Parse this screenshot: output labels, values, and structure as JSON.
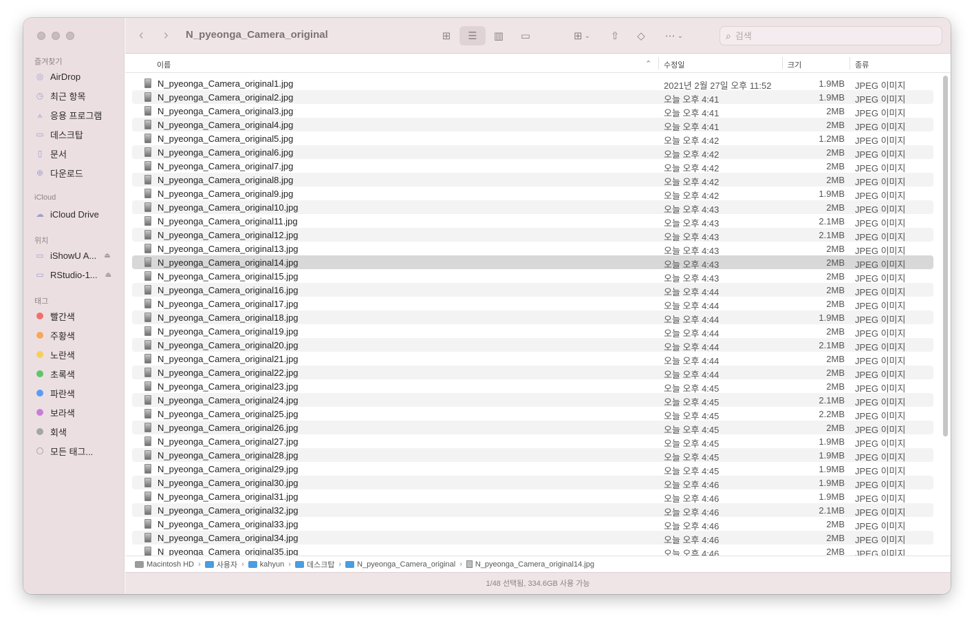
{
  "window": {
    "title": "N_pyeonga_Camera_original"
  },
  "search": {
    "placeholder": "검색"
  },
  "sidebar": {
    "favorites_label": "즐겨찾기",
    "favorites": [
      {
        "label": "AirDrop",
        "icon": "airdrop-icon"
      },
      {
        "label": "최근 항목",
        "icon": "clock-icon"
      },
      {
        "label": "응용 프로그램",
        "icon": "applications-icon"
      },
      {
        "label": "데스크탑",
        "icon": "desktop-icon"
      },
      {
        "label": "문서",
        "icon": "document-icon"
      },
      {
        "label": "다운로드",
        "icon": "download-icon"
      }
    ],
    "icloud_label": "iCloud",
    "icloud": [
      {
        "label": "iCloud Drive",
        "icon": "cloud-icon"
      }
    ],
    "locations_label": "위치",
    "locations": [
      {
        "label": "iShowU A...",
        "icon": "drive-icon"
      },
      {
        "label": "RStudio-1...",
        "icon": "drive-icon"
      }
    ],
    "tags_label": "태그",
    "tags": [
      {
        "label": "빨간색",
        "color": "#f0706d"
      },
      {
        "label": "주황색",
        "color": "#f5a85a"
      },
      {
        "label": "노란색",
        "color": "#f5cf5a"
      },
      {
        "label": "초록색",
        "color": "#5ec56a"
      },
      {
        "label": "파란색",
        "color": "#5a9cf5"
      },
      {
        "label": "보라색",
        "color": "#c77fd6"
      },
      {
        "label": "회색",
        "color": "#a5a5a5"
      },
      {
        "label": "모든 태그...",
        "color": ""
      }
    ]
  },
  "columns": {
    "name": "이름",
    "date": "수정일",
    "size": "크기",
    "kind": "종류"
  },
  "files": [
    {
      "name": "N_pyeonga_Camera_original1.jpg",
      "date": "2021년 2월 27일 오후 11:52",
      "size": "1.9MB",
      "kind": "JPEG 이미지"
    },
    {
      "name": "N_pyeonga_Camera_original2.jpg",
      "date": "오늘 오후 4:41",
      "size": "1.9MB",
      "kind": "JPEG 이미지"
    },
    {
      "name": "N_pyeonga_Camera_original3.jpg",
      "date": "오늘 오후 4:41",
      "size": "2MB",
      "kind": "JPEG 이미지"
    },
    {
      "name": "N_pyeonga_Camera_original4.jpg",
      "date": "오늘 오후 4:41",
      "size": "2MB",
      "kind": "JPEG 이미지"
    },
    {
      "name": "N_pyeonga_Camera_original5.jpg",
      "date": "오늘 오후 4:42",
      "size": "1.2MB",
      "kind": "JPEG 이미지"
    },
    {
      "name": "N_pyeonga_Camera_original6.jpg",
      "date": "오늘 오후 4:42",
      "size": "2MB",
      "kind": "JPEG 이미지"
    },
    {
      "name": "N_pyeonga_Camera_original7.jpg",
      "date": "오늘 오후 4:42",
      "size": "2MB",
      "kind": "JPEG 이미지"
    },
    {
      "name": "N_pyeonga_Camera_original8.jpg",
      "date": "오늘 오후 4:42",
      "size": "2MB",
      "kind": "JPEG 이미지"
    },
    {
      "name": "N_pyeonga_Camera_original9.jpg",
      "date": "오늘 오후 4:42",
      "size": "1.9MB",
      "kind": "JPEG 이미지"
    },
    {
      "name": "N_pyeonga_Camera_original10.jpg",
      "date": "오늘 오후 4:43",
      "size": "2MB",
      "kind": "JPEG 이미지"
    },
    {
      "name": "N_pyeonga_Camera_original11.jpg",
      "date": "오늘 오후 4:43",
      "size": "2.1MB",
      "kind": "JPEG 이미지"
    },
    {
      "name": "N_pyeonga_Camera_original12.jpg",
      "date": "오늘 오후 4:43",
      "size": "2.1MB",
      "kind": "JPEG 이미지"
    },
    {
      "name": "N_pyeonga_Camera_original13.jpg",
      "date": "오늘 오후 4:43",
      "size": "2MB",
      "kind": "JPEG 이미지"
    },
    {
      "name": "N_pyeonga_Camera_original14.jpg",
      "date": "오늘 오후 4:43",
      "size": "2MB",
      "kind": "JPEG 이미지",
      "selected": true
    },
    {
      "name": "N_pyeonga_Camera_original15.jpg",
      "date": "오늘 오후 4:43",
      "size": "2MB",
      "kind": "JPEG 이미지"
    },
    {
      "name": "N_pyeonga_Camera_original16.jpg",
      "date": "오늘 오후 4:44",
      "size": "2MB",
      "kind": "JPEG 이미지"
    },
    {
      "name": "N_pyeonga_Camera_original17.jpg",
      "date": "오늘 오후 4:44",
      "size": "2MB",
      "kind": "JPEG 이미지"
    },
    {
      "name": "N_pyeonga_Camera_original18.jpg",
      "date": "오늘 오후 4:44",
      "size": "1.9MB",
      "kind": "JPEG 이미지"
    },
    {
      "name": "N_pyeonga_Camera_original19.jpg",
      "date": "오늘 오후 4:44",
      "size": "2MB",
      "kind": "JPEG 이미지"
    },
    {
      "name": "N_pyeonga_Camera_original20.jpg",
      "date": "오늘 오후 4:44",
      "size": "2.1MB",
      "kind": "JPEG 이미지"
    },
    {
      "name": "N_pyeonga_Camera_original21.jpg",
      "date": "오늘 오후 4:44",
      "size": "2MB",
      "kind": "JPEG 이미지"
    },
    {
      "name": "N_pyeonga_Camera_original22.jpg",
      "date": "오늘 오후 4:44",
      "size": "2MB",
      "kind": "JPEG 이미지"
    },
    {
      "name": "N_pyeonga_Camera_original23.jpg",
      "date": "오늘 오후 4:45",
      "size": "2MB",
      "kind": "JPEG 이미지"
    },
    {
      "name": "N_pyeonga_Camera_original24.jpg",
      "date": "오늘 오후 4:45",
      "size": "2.1MB",
      "kind": "JPEG 이미지"
    },
    {
      "name": "N_pyeonga_Camera_original25.jpg",
      "date": "오늘 오후 4:45",
      "size": "2.2MB",
      "kind": "JPEG 이미지"
    },
    {
      "name": "N_pyeonga_Camera_original26.jpg",
      "date": "오늘 오후 4:45",
      "size": "2MB",
      "kind": "JPEG 이미지"
    },
    {
      "name": "N_pyeonga_Camera_original27.jpg",
      "date": "오늘 오후 4:45",
      "size": "1.9MB",
      "kind": "JPEG 이미지"
    },
    {
      "name": "N_pyeonga_Camera_original28.jpg",
      "date": "오늘 오후 4:45",
      "size": "1.9MB",
      "kind": "JPEG 이미지"
    },
    {
      "name": "N_pyeonga_Camera_original29.jpg",
      "date": "오늘 오후 4:45",
      "size": "1.9MB",
      "kind": "JPEG 이미지"
    },
    {
      "name": "N_pyeonga_Camera_original30.jpg",
      "date": "오늘 오후 4:46",
      "size": "1.9MB",
      "kind": "JPEG 이미지"
    },
    {
      "name": "N_pyeonga_Camera_original31.jpg",
      "date": "오늘 오후 4:46",
      "size": "1.9MB",
      "kind": "JPEG 이미지"
    },
    {
      "name": "N_pyeonga_Camera_original32.jpg",
      "date": "오늘 오후 4:46",
      "size": "2.1MB",
      "kind": "JPEG 이미지"
    },
    {
      "name": "N_pyeonga_Camera_original33.jpg",
      "date": "오늘 오후 4:46",
      "size": "2MB",
      "kind": "JPEG 이미지"
    },
    {
      "name": "N_pyeonga_Camera_original34.jpg",
      "date": "오늘 오후 4:46",
      "size": "2MB",
      "kind": "JPEG 이미지"
    },
    {
      "name": "N_pyeonga_Camera_original35.jpg",
      "date": "오늘 오후 4:46",
      "size": "2MB",
      "kind": "JPEG 이미지"
    }
  ],
  "path": [
    {
      "label": "Macintosh HD",
      "icon": "hard-drive-icon"
    },
    {
      "label": "사용자",
      "icon": "folder-icon"
    },
    {
      "label": "kahyun",
      "icon": "folder-icon"
    },
    {
      "label": "데스크탑",
      "icon": "folder-icon"
    },
    {
      "label": "N_pyeonga_Camera_original",
      "icon": "folder-icon"
    },
    {
      "label": "N_pyeonga_Camera_original14.jpg",
      "icon": "file-icon"
    }
  ],
  "status": "1/48 선택됨, 334.6GB 사용 가능"
}
